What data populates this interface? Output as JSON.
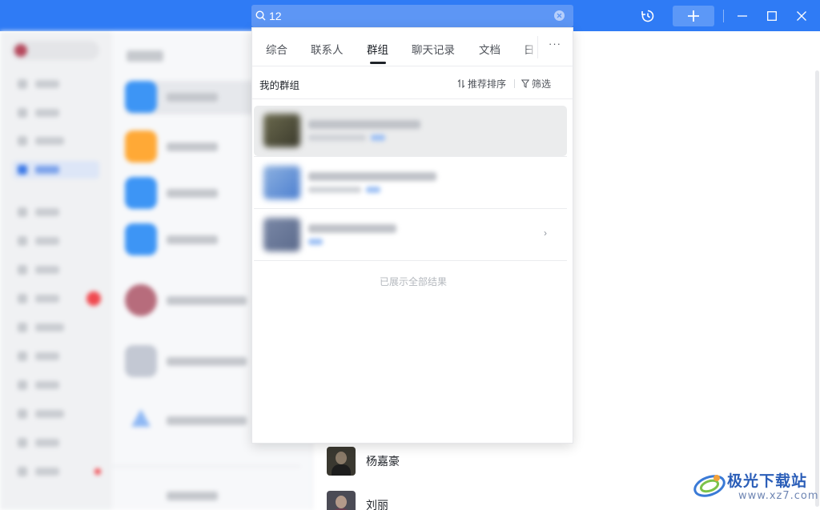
{
  "search": {
    "query": "12"
  },
  "tabs": [
    {
      "label": "综合"
    },
    {
      "label": "联系人"
    },
    {
      "label": "群组"
    },
    {
      "label": "聊天记录"
    },
    {
      "label": "文档"
    },
    {
      "label": "日"
    }
  ],
  "more_label": "···",
  "section": {
    "title": "我的群组",
    "sort_label": "推荐排序",
    "filter_label": "筛选"
  },
  "results_footer": "已展示全部结果",
  "chevron": "›",
  "contacts": [
    {
      "name": "杨嘉豪"
    },
    {
      "name": "刘丽"
    }
  ],
  "watermark": {
    "text": "极光下载站",
    "url": "www.xz7.com"
  },
  "colors": {
    "titlebar": "#2f7bf5",
    "search_bar": "#5d96f5",
    "accent": "#3e7ae6"
  }
}
